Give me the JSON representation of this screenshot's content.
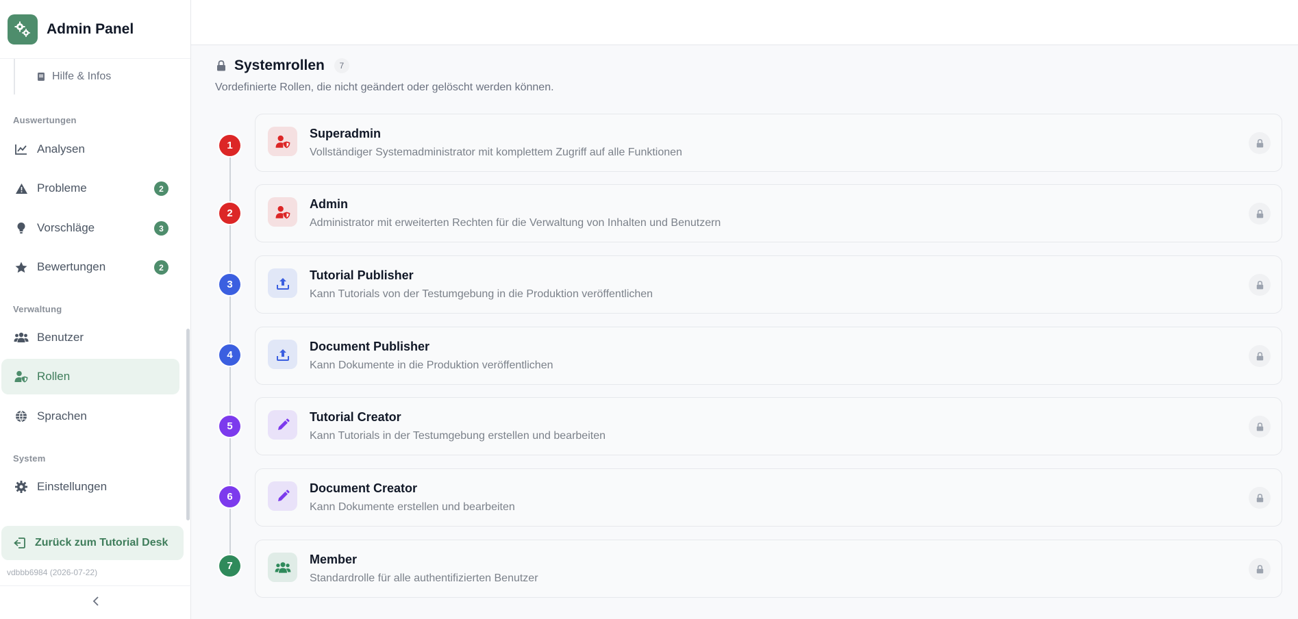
{
  "app": {
    "title": "Admin Panel"
  },
  "sidebar": {
    "sub_item": {
      "label": "Hilfe & Infos",
      "icon": "book-icon"
    },
    "sections": [
      {
        "label": "Auswertungen"
      },
      {
        "label": "Verwaltung"
      },
      {
        "label": "System"
      }
    ],
    "items": [
      {
        "label": "Analysen",
        "icon": "chart-line-icon"
      },
      {
        "label": "Probleme",
        "icon": "warning-icon",
        "badge": "2"
      },
      {
        "label": "Vorschläge",
        "icon": "lightbulb-icon",
        "badge": "3"
      },
      {
        "label": "Bewertungen",
        "icon": "star-icon",
        "badge": "2"
      },
      {
        "label": "Benutzer",
        "icon": "users-icon"
      },
      {
        "label": "Rollen",
        "icon": "user-shield-icon",
        "active": true
      },
      {
        "label": "Sprachen",
        "icon": "globe-icon"
      },
      {
        "label": "Einstellungen",
        "icon": "gear-icon"
      }
    ],
    "back_button": "Zurück zum Tutorial Desk",
    "version": "vdbbb6984 (2026-07-22)"
  },
  "main": {
    "section_title": "Systemrollen",
    "section_count": "7",
    "section_subtitle": "Vordefinierte Rollen, die nicht geändert oder gelöscht werden können.",
    "roles": [
      {
        "number": "1",
        "name": "Superadmin",
        "description": "Vollständiger Systemadministrator mit komplettem Zugriff auf alle Funktionen",
        "icon": "user-shield-icon",
        "color": "#dc2626"
      },
      {
        "number": "2",
        "name": "Admin",
        "description": "Administrator mit erweiterten Rechten für die Verwaltung von Inhalten und Benutzern",
        "icon": "user-shield-icon",
        "color": "#dc2626"
      },
      {
        "number": "3",
        "name": "Tutorial Publisher",
        "description": "Kann Tutorials von der Testumgebung in die Produktion veröffentlichen",
        "icon": "upload-icon",
        "color": "#3b5fe0"
      },
      {
        "number": "4",
        "name": "Document Publisher",
        "description": "Kann Dokumente in die Produktion veröffentlichen",
        "icon": "upload-icon",
        "color": "#3b5fe0"
      },
      {
        "number": "5",
        "name": "Tutorial Creator",
        "description": "Kann Tutorials in der Testumgebung erstellen und bearbeiten",
        "icon": "pencil-icon",
        "color": "#7c3aed"
      },
      {
        "number": "6",
        "name": "Document Creator",
        "description": "Kann Dokumente erstellen und bearbeiten",
        "icon": "pencil-icon",
        "color": "#7c3aed"
      },
      {
        "number": "7",
        "name": "Member",
        "description": "Standardrolle für alle authentifizierten Benutzer",
        "icon": "users-icon",
        "color": "#2f8a5b"
      }
    ]
  },
  "colors": {
    "accent": "#4e8d6c",
    "accent_bg": "#eaf3ee"
  }
}
